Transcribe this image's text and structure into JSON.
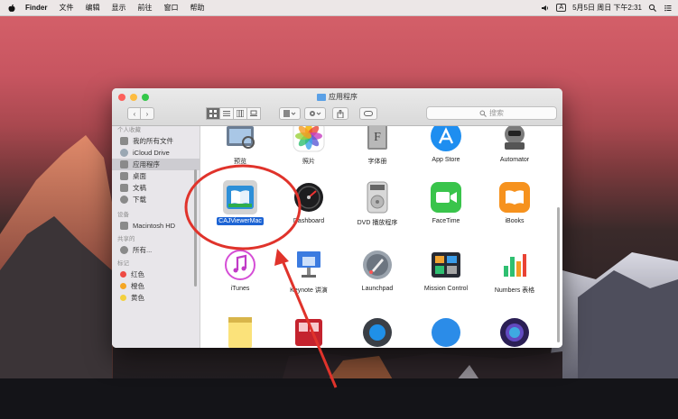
{
  "menubar": {
    "app_name": "Finder",
    "items": [
      "文件",
      "编辑",
      "显示",
      "前往",
      "窗口",
      "帮助"
    ],
    "input_label": "A",
    "datetime": "5月5日 周日 下午2:31"
  },
  "window": {
    "title": "应用程序",
    "search_placeholder": "搜索"
  },
  "sidebar": {
    "sections": [
      {
        "header": "个人收藏",
        "items": [
          {
            "label": "我的所有文件",
            "icon": "all-files-icon"
          },
          {
            "label": "iCloud Drive",
            "icon": "cloud-icon"
          },
          {
            "label": "应用程序",
            "icon": "applications-icon",
            "selected": true
          },
          {
            "label": "桌面",
            "icon": "desktop-icon"
          },
          {
            "label": "文稿",
            "icon": "documents-icon"
          },
          {
            "label": "下载",
            "icon": "downloads-icon"
          }
        ]
      },
      {
        "header": "设备",
        "items": [
          {
            "label": "Macintosh HD",
            "icon": "disk-icon"
          }
        ]
      },
      {
        "header": "共享的",
        "items": [
          {
            "label": "所有...",
            "icon": "network-icon"
          }
        ]
      },
      {
        "header": "标记",
        "items": [
          {
            "label": "红色",
            "color": "#ee4a43"
          },
          {
            "label": "橙色",
            "color": "#f5a623"
          },
          {
            "label": "黄色",
            "color": "#f3d03e"
          }
        ]
      }
    ]
  },
  "apps": [
    {
      "label": "预览",
      "icon": "preview-icon"
    },
    {
      "label": "照片",
      "icon": "photos-icon"
    },
    {
      "label": "字体册",
      "icon": "font-book-icon"
    },
    {
      "label": "App Store",
      "icon": "app-store-icon"
    },
    {
      "label": "Automator",
      "icon": "automator-icon"
    },
    {
      "label": "CAJViewerMac",
      "icon": "cajviewer-icon",
      "selected": true
    },
    {
      "label": "Dashboard",
      "icon": "dashboard-icon"
    },
    {
      "label": "DVD 播放程序",
      "icon": "dvd-player-icon"
    },
    {
      "label": "FaceTime",
      "icon": "facetime-icon"
    },
    {
      "label": "iBooks",
      "icon": "ibooks-icon"
    },
    {
      "label": "iTunes",
      "icon": "itunes-icon"
    },
    {
      "label": "Keynote 讲演",
      "icon": "keynote-icon"
    },
    {
      "label": "Launchpad",
      "icon": "launchpad-icon"
    },
    {
      "label": "Mission Control",
      "icon": "mission-control-icon"
    },
    {
      "label": "Numbers 表格",
      "icon": "numbers-icon"
    },
    {
      "label": "",
      "icon": "notes-icon"
    },
    {
      "label": "",
      "icon": "photo-booth-icon"
    },
    {
      "label": "",
      "icon": "quicktime-icon"
    },
    {
      "label": "",
      "icon": "safari-icon"
    },
    {
      "label": "",
      "icon": "siri-icon"
    }
  ],
  "annotation": {
    "color": "#e0332b"
  }
}
